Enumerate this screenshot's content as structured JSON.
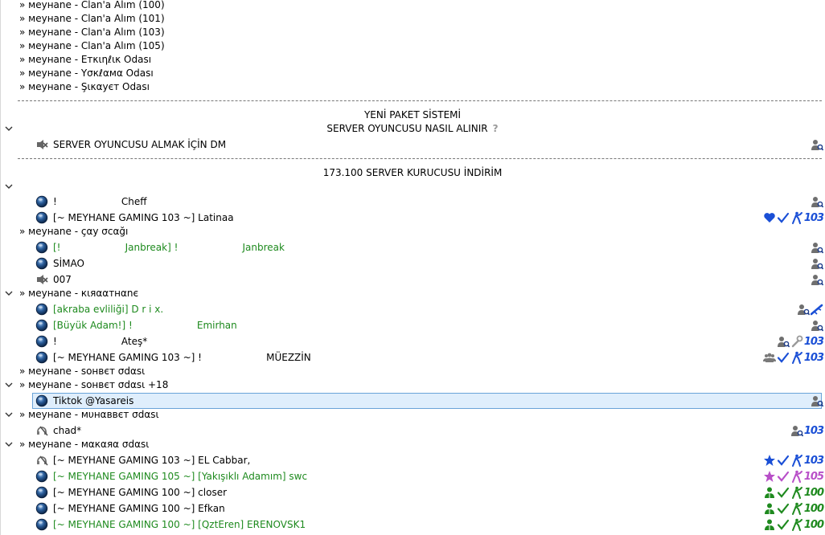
{
  "channels_top": [
    "» меунаne - Clan'a Alım (100)",
    "» меунаne - Clan'a Alım (101)",
    "» меунаne - Clan'a Alım (103)",
    "» меунаne - Clan'a Alım (105)",
    "» меунаne - Етκιηℓικ Odası",
    "» меунаne - Үσкℓαмα Odası",
    "» меунаne - Şικαуєт Odası"
  ],
  "spacers": {
    "paket": "YENİ PAKET SİSTEMİ",
    "server_q": "SERVER OYUNCUSU NASIL ALINIR",
    "server_dm": "SERVER OYUNCUSU ALMAK İÇİN DM",
    "kurucu": "173.100 SERVER KURUCUSU İNDİRİM"
  },
  "users": {
    "cheff": "!                     Cheff",
    "latinaa": "[~ MEYHANE GAMING 103 ~] Latinaa",
    "janbreak": "[!                     Janbreak] !                     Janbreak",
    "simao": "SİMAO",
    "u007": "007",
    "drix": "[akraba evliliği] D r i x.",
    "emirhan": "[Büyük Adam!] !                     Emirhan",
    "ates": "!                     Ateş*",
    "muezzin": "[~ MEYHANE GAMING 103 ~] !                     MÜEZZİN",
    "tiktok": "Tiktok @Yasareis",
    "chad": "chad*",
    "cabbar": "[~ MEYHANE GAMING 103 ~] EL Cabbar,",
    "swc": "[~ MEYHANE GAMING 105 ~] [Yakışıklı Adamım] swc",
    "closer": "[~ MEYHANE GAMING 100 ~] closer",
    "efkan": "[~ MEYHANE GAMING 100 ~] Efkan",
    "erenovsk": "[~ MEYHANE GAMING 100 ~] [QztEren] ERENOVSK1"
  },
  "channels": {
    "cay": "» меунаne - çαу σcαğı",
    "kiraat": "» меунаne - кιяααтнαnє",
    "sohbet": "» меунаne - ѕонвєт σdαѕι",
    "sohbet18": "» меунаne - ѕонвєт σdαѕι +18",
    "muhabbet": "» меунаne - мυнαввєт σdαѕι",
    "makara": "» меунаne - мαкαяα σdαѕι"
  },
  "badge_numbers": {
    "latinaa": "103",
    "ates": "103",
    "muezzin": "103",
    "chad": "103",
    "cabbar": "103",
    "swc": "105",
    "closer": "100",
    "efkan": "100",
    "erenovsk": "100"
  },
  "colors": {
    "blue": "#1a4fd6",
    "purple": "#b84fc8",
    "green": "#1f8a1f",
    "text_green": "#1e8a1e",
    "selection": "#dfeefc"
  }
}
